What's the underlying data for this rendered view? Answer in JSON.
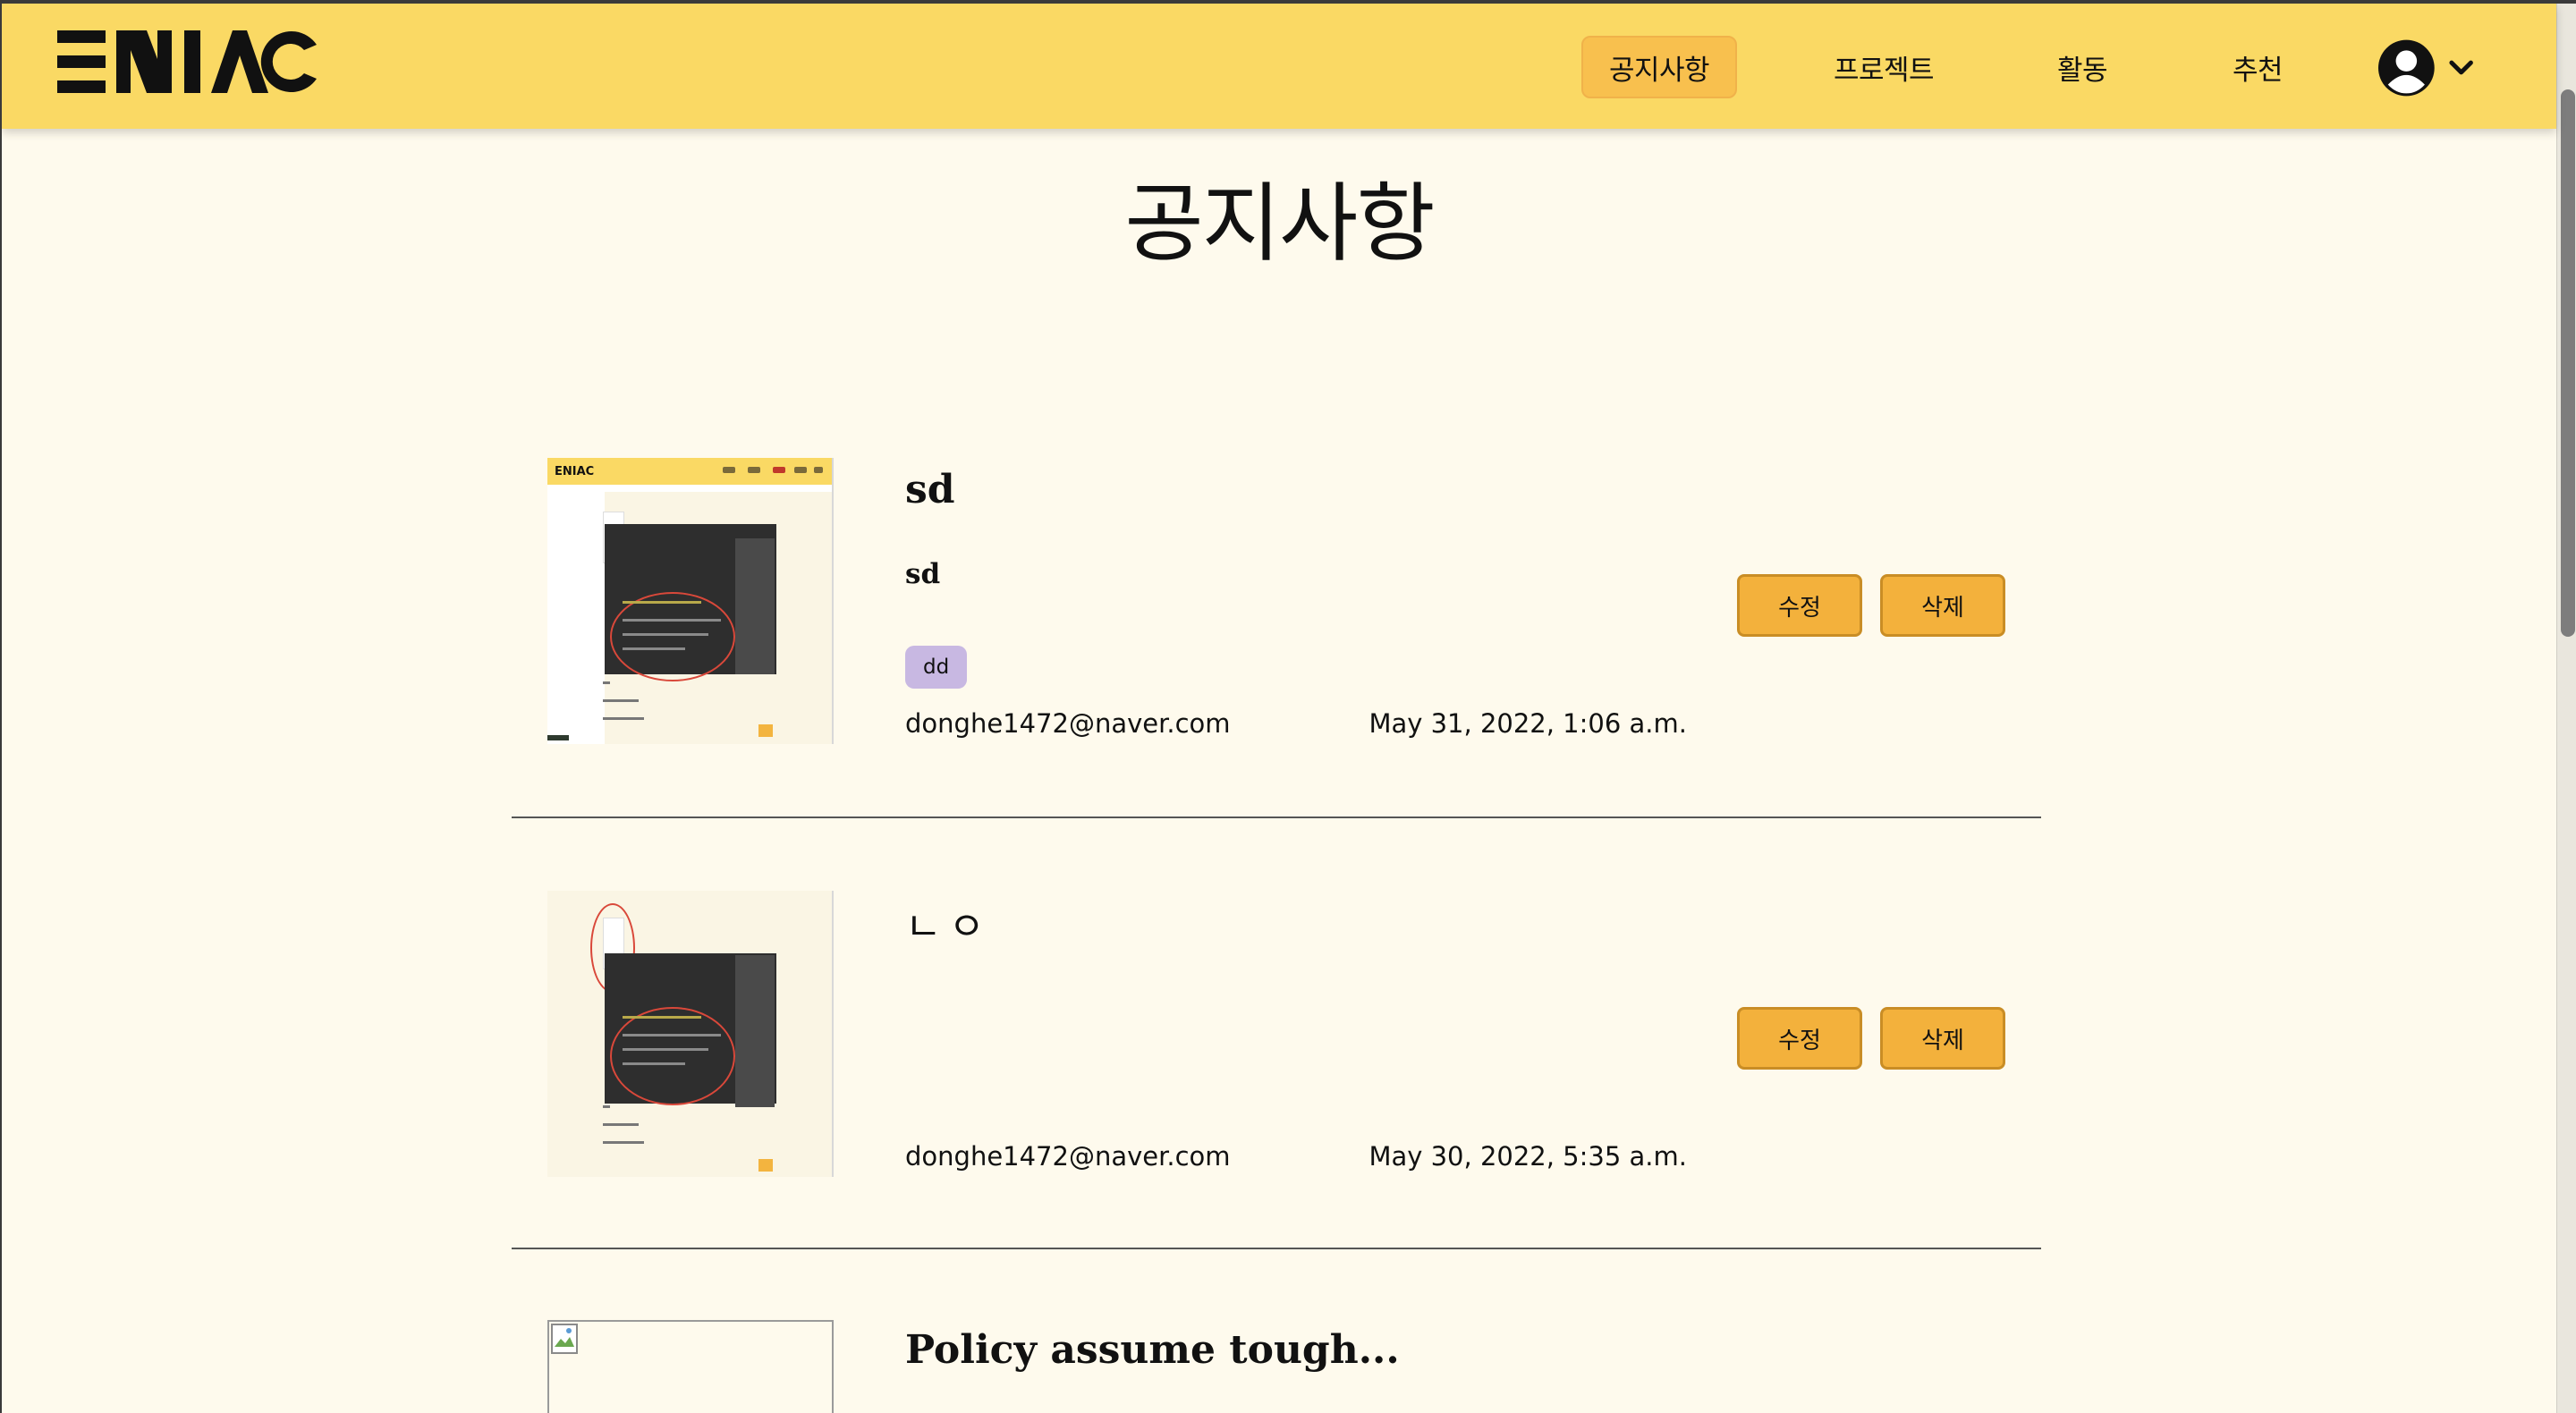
{
  "header": {
    "brand": "ENIAC",
    "nav": [
      {
        "label": "공지사항",
        "active": true
      },
      {
        "label": "프로젝트",
        "active": false
      },
      {
        "label": "활동",
        "active": false
      },
      {
        "label": "추천",
        "active": false
      }
    ],
    "user_icon": "user-circle-icon",
    "dropdown_icon": "chevron-down-icon"
  },
  "page": {
    "title": "공지사항"
  },
  "posts": [
    {
      "title": "sd",
      "body": "sd",
      "tag": "dd",
      "author": "donghe1472@naver.com",
      "date": "May 31, 2022, 1:06 a.m.",
      "edit_label": "수정",
      "delete_label": "삭제"
    },
    {
      "title": "ㄴㅇ",
      "body": "",
      "author": "donghe1472@naver.com",
      "date": "May 30, 2022, 5:35 a.m.",
      "edit_label": "수정",
      "delete_label": "삭제"
    },
    {
      "title": "Policy assume tough..."
    }
  ],
  "colors": {
    "header_bg": "#fad964",
    "nav_active_bg": "#f8c04e",
    "page_bg": "#fefaed",
    "button_bg": "#f3b13c",
    "tag_bg": "#c8b8e2"
  }
}
